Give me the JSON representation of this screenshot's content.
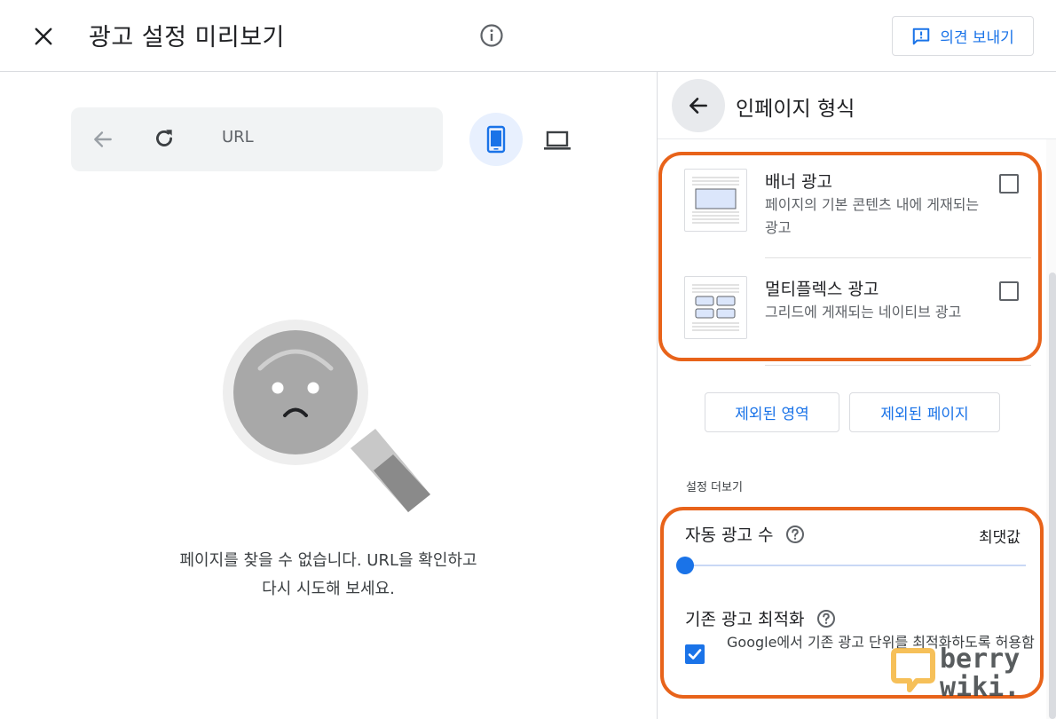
{
  "header": {
    "title": "광고 설정 미리보기",
    "feedback_label": "의견 보내기"
  },
  "preview": {
    "url_placeholder": "URL",
    "error_line1": "페이지를 찾을 수 없습니다. URL을 확인하고",
    "error_line2": "다시 시도해 보세요."
  },
  "panel": {
    "title": "인페이지 형식",
    "formats": [
      {
        "name": "배너 광고",
        "desc": "페이지의 기본 콘텐츠 내에 게재되는 광고",
        "checked": false
      },
      {
        "name": "멀티플렉스 광고",
        "desc": "그리드에 게재되는 네이티브 광고",
        "checked": false
      }
    ],
    "excluded_regions_label": "제외된 영역",
    "excluded_pages_label": "제외된 페이지",
    "more_settings_label": "설정 더보기",
    "ad_load": {
      "label": "자동 광고 수",
      "value_label": "최댓값",
      "slider_value": 0
    },
    "optimize": {
      "label": "기존 광고 최적화",
      "desc": "Google에서 기존 광고 단위를 최적화하도록 허용함",
      "checked": true
    }
  },
  "watermark": {
    "line1": "berry",
    "line2": "wiki."
  },
  "colors": {
    "accent": "#1a73e8",
    "highlight": "#e8631a"
  }
}
